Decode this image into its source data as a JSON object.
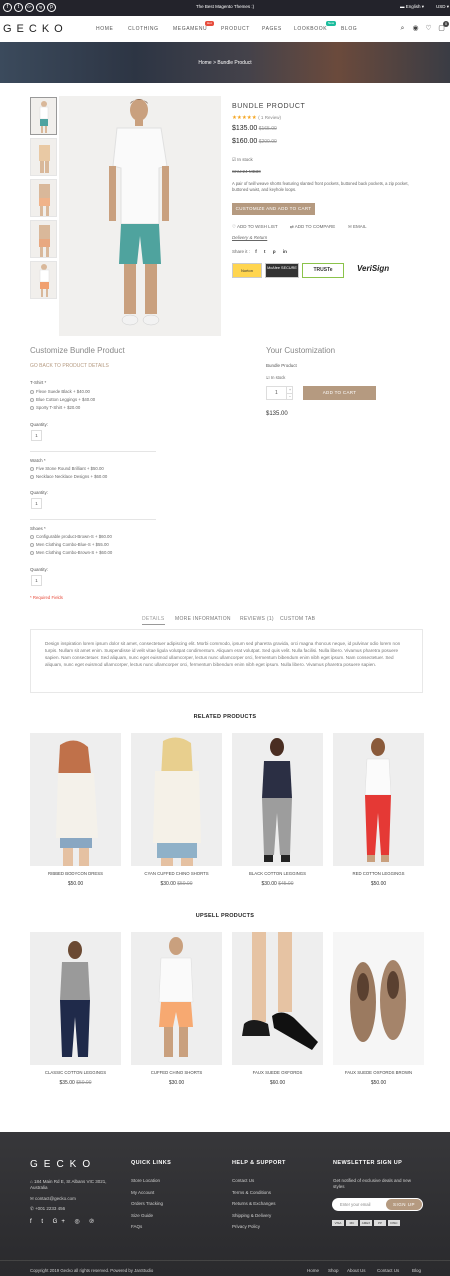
{
  "topbar": {
    "social": [
      "f",
      "t",
      "G+",
      "ig",
      "p"
    ],
    "promo": "The Best Magento Themes :)",
    "language": "English",
    "currency": "USD"
  },
  "header": {
    "logo": "GECKO",
    "nav": [
      "HOME",
      "CLOTHING",
      "MEGAMENU",
      "PRODUCT",
      "PAGES",
      "LOOKBOOK",
      "BLOG"
    ],
    "megamenu_badge": "Hot",
    "lookbook_badge": "New",
    "cart_count": "0"
  },
  "breadcrumb": {
    "home": "Home",
    "sep": ">",
    "current": "Bundle Product"
  },
  "product": {
    "name": "BUNDLE PRODUCT",
    "stars": "★★★★★",
    "reviews": "( 1 Review)",
    "price1": "$135.00",
    "old1": "$165.00",
    "price2": "$160.00",
    "old2": "$200.00",
    "stock": "In stock",
    "sku": "SKU:24-MB30",
    "short_desc": "A pair of twill weave shorts featuring slanted front pockets, buttoned back pockets, a zip pocket, buttoned waist, and keyhole loops.",
    "customize_btn": "CUSTOMIZE AND ADD TO CART",
    "wishlist": "ADD TO WISH LIST",
    "compare": "ADD TO COMPARE",
    "email": "EMAIL",
    "delivery": "Delivery & Return",
    "share": "Share it",
    "share_icons": [
      "f",
      "t",
      "p",
      "in"
    ],
    "trust": [
      "Norton",
      "McAfee SECURE",
      "TRUSTe",
      "VeriSign"
    ]
  },
  "customize": {
    "title": "Customize Bundle Product",
    "back": "GO BACK TO PRODUCT DETAILS",
    "groups": [
      {
        "label": "T-Shirt *",
        "options": [
          "Flexe Suede Black  + $40.00",
          "Blue Cotton Leggings  + $40.00",
          "Sporty T-Shirt  + $20.00"
        ],
        "qty_label": "Quantity:",
        "qty": "1"
      },
      {
        "label": "Watch *",
        "options": [
          "Five Stone Round Brilliant  + $50.00",
          "Necklace Necklace Designs  + $60.00"
        ],
        "qty_label": "Quantity:",
        "qty": "1"
      },
      {
        "label": "Shoes *",
        "options": [
          "Configurable product-Brown-S  + $60.00",
          "Men Clothing Combo-Blue-S  + $55.00",
          "Men Clothing Combo-Brown-S  + $60.00"
        ],
        "qty_label": "Quantity:",
        "qty": "1"
      }
    ],
    "required": "* Required Fields"
  },
  "your_custom": {
    "title": "Your Customization",
    "product": "Bundle Product",
    "stock": "In stock",
    "qty": "1",
    "add_btn": "ADD TO CART",
    "price": "$135.00"
  },
  "tabs": [
    "DETAILS",
    "MORE INFORMATION",
    "REVIEWS (1)",
    "CUSTOM TAB"
  ],
  "details_text": "Design inspiration lorem ipsum dolor sit amet, consectetuer adipiscing elit. Morbi commodo, ipsum sed pharetra gravida, orci magna rhoncus neque, id pulvinar odio lorem non turpis. Nullam sit amet enim. Suspendisse id velit vitae ligula volutpat condimentum. Aliquam erat volutpat. Sed quis velit. Nulla facilisi. Nulla libero. Vivamus pharetra posuere sapien. Nam consectetuer. Sed aliquam, nunc eget euismod ullamcorper, lectus nunc ullamcorper orci, fermentum bibendum enim nibh eget ipsum. Nam consectetuer. Sed aliquam, nunc eget euismod ullamcorper, lectus nunc ullamcorper orci, fermentum bibendum enim nibh eget ipsum. Nulla libero. Vivamus pharetra posuere sapien.",
  "related": {
    "title": "RELATED PRODUCTS",
    "items": [
      {
        "name": "RIBBED BODYCON DRESS",
        "price": "$50.00",
        "old": ""
      },
      {
        "name": "CYAN CUFFED CHINO SHORTS",
        "price": "$30.00",
        "old": "$50.00"
      },
      {
        "name": "BLACK COTTON LEGGINGS",
        "price": "$30.00",
        "old": "$45.00"
      },
      {
        "name": "RED COTTON LEGGINGS",
        "price": "$50.00",
        "old": ""
      }
    ]
  },
  "upsell": {
    "title": "UPSELL PRODUCTS",
    "items": [
      {
        "name": "CLASSIC COTTON LEGGINGS",
        "price": "$35.00",
        "old": "$50.00"
      },
      {
        "name": "CUFFED CHINO SHORTS",
        "price": "$30.00",
        "old": ""
      },
      {
        "name": "FAUX SUEDE OXFORDS",
        "price": "$60.00",
        "old": ""
      },
      {
        "name": "FAUX SUEDE OXFORDS BROWN",
        "price": "$50.00",
        "old": ""
      }
    ]
  },
  "footer": {
    "logo": "GECKO",
    "address": "184 Main Rd E, St Albans VIC 3021, Australia",
    "email": "contact@gecko.com",
    "phone": "+001 2233 456",
    "quick_title": "QUICK LINKS",
    "quick": [
      "Store Location",
      "My Account",
      "Orders Tracking",
      "Size Guide",
      "FAQs"
    ],
    "help_title": "HELP & SUPPORT",
    "help": [
      "Contact Us",
      "Terms & Conditions",
      "Returns & Exchanges",
      "Shipping & Delivery",
      "Privacy Policy"
    ],
    "news_title": "NEWSLETTER SIGN UP",
    "news_text": "Get notified of exclusive deals and new styles",
    "news_placeholder": "Enter your email",
    "news_btn": "SIGN UP",
    "payments": [
      "VISA",
      "MC",
      "AMEX",
      "PP",
      "DISC"
    ],
    "copyright": "Copyright 2019 Gecko all rights reserved. Powered by JanStudio",
    "bottom_links": [
      "Home",
      "Shop",
      "About Us",
      "Contact Us",
      "Blog"
    ]
  },
  "colors": {
    "accent": "#b59a80",
    "dark": "#23232b",
    "hot": "#e74c3c",
    "new": "#1abc9c"
  }
}
